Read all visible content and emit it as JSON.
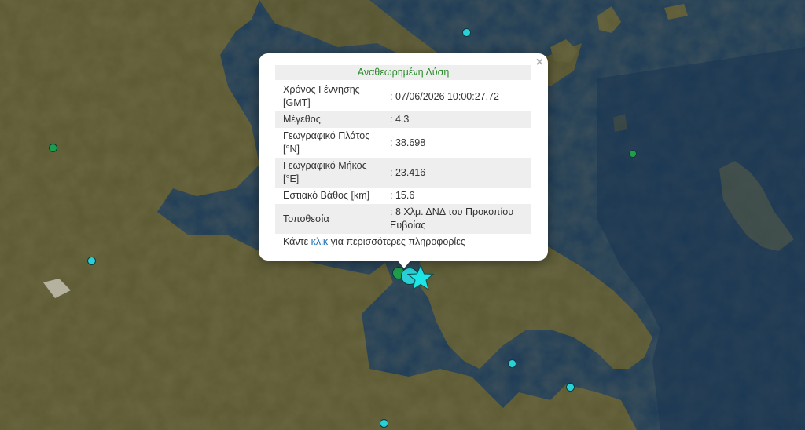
{
  "popup": {
    "title": "Αναθεωρημένη Λύση",
    "close_symbol": "×",
    "rows": [
      {
        "label": "Χρόνος Γέννησης [GMT]",
        "value": ": 07/06/2026 10:00:27.72"
      },
      {
        "label": "Μέγεθος",
        "value": ": 4.3"
      },
      {
        "label": "Γεωγραφικό Πλάτος [°N]",
        "value": ": 38.698"
      },
      {
        "label": "Γεωγραφικό Μήκος [°E]",
        "value": ": 23.416"
      },
      {
        "label": "Εστιακό Βάθος [km]",
        "value": ": 15.6"
      },
      {
        "label": "Τοποθεσία",
        "value": ": 8 Χλμ. ΔΝΔ του Προκοπίου Ευβοίας"
      }
    ],
    "footer_prefix": "Κάντε",
    "footer_link": "κλικ",
    "footer_suffix": "για περισσότερες πληροφορίες"
  },
  "colors": {
    "marker_cyan": "#2ad0d8",
    "marker_green": "#1f9e4a",
    "star": "#1ee6e6",
    "title_green": "#2b8a2b",
    "link_blue": "#1a6eb3"
  },
  "icons": {
    "latest_event": "star-icon",
    "close": "close-icon"
  }
}
